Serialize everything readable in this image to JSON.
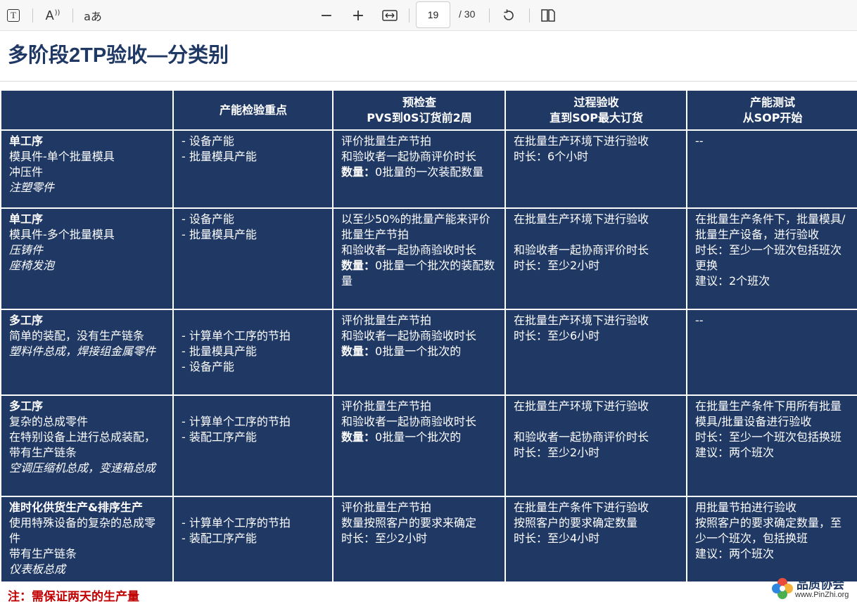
{
  "toolbar": {
    "text_tool_glyph": "T",
    "read_aloud_glyph": "A",
    "translate_glyph": "aあ",
    "zoom_out_glyph": "−",
    "zoom_in_glyph": "+",
    "page_current": "19",
    "page_total": "/ 30",
    "icons": [
      "text-select-icon",
      "read-aloud-icon",
      "translate-icon",
      "zoom-out-icon",
      "zoom-in-icon",
      "fit-width-icon",
      "rotate-icon",
      "page-view-icon"
    ]
  },
  "slide": {
    "title": "多阶段2TP验收—分类别",
    "headers": [
      [
        ""
      ],
      [
        "产能检验重点"
      ],
      [
        "预检查",
        "PVS到0S订货前2周"
      ],
      [
        "过程验收",
        "直到SOP最大订货"
      ],
      [
        "产能测试",
        "从SOP开始"
      ]
    ],
    "rows": [
      [
        [
          {
            "t": "单工序",
            "s": "b"
          },
          {
            "t": "模具件-单个批量模具",
            "s": ""
          },
          {
            "t": "冲压件",
            "s": ""
          },
          {
            "t": "注塑零件",
            "s": "i"
          }
        ],
        [
          {
            "t": "- 设备产能",
            "s": ""
          },
          {
            "t": "- 批量模具产能",
            "s": ""
          }
        ],
        [
          {
            "t": "评价批量生产节拍",
            "s": ""
          },
          {
            "t": "和验收者一起协商评价时长",
            "s": ""
          },
          {
            "t": "数量：",
            "s": "b",
            "rest": "0批量的一次装配数量"
          }
        ],
        [
          {
            "t": "在批量生产环境下进行验收",
            "s": ""
          },
          {
            "t": "时长：6个小时",
            "s": ""
          }
        ],
        [
          {
            "t": "--",
            "s": ""
          }
        ]
      ],
      [
        [
          {
            "t": "单工序",
            "s": "b"
          },
          {
            "t": "模具件-多个批量模具",
            "s": ""
          },
          {
            "t": "压铸件",
            "s": "i"
          },
          {
            "t": "座椅发泡",
            "s": "i"
          }
        ],
        [
          {
            "t": "- 设备产能",
            "s": ""
          },
          {
            "t": "- 批量模具产能",
            "s": ""
          }
        ],
        [
          {
            "t": "以至少50%的批量产能来评价批量生产节拍",
            "s": ""
          },
          {
            "t": "和验收者一起协商验收时长",
            "s": ""
          },
          {
            "t": "数量：",
            "s": "b",
            "rest": "0批量一个批次的装配数量"
          }
        ],
        [
          {
            "t": "在批量生产环境下进行验收",
            "s": ""
          },
          {
            "t": " ",
            "s": ""
          },
          {
            "t": "和验收者一起协商评价时长",
            "s": ""
          },
          {
            "t": "时长：至少2小时",
            "s": ""
          }
        ],
        [
          {
            "t": "在批量生产条件下，批量模具/批量生产设备，进行验收",
            "s": ""
          },
          {
            "t": "时长：至少一个班次包括班次更换",
            "s": ""
          },
          {
            "t": "建议：2个班次",
            "s": ""
          }
        ]
      ],
      [
        [
          {
            "t": "多工序",
            "s": "b"
          },
          {
            "t": "简单的装配，没有生产链条",
            "s": ""
          },
          {
            "t": "塑料件总成，焊接组金属零件",
            "s": "i"
          }
        ],
        [
          {
            "t": " ",
            "s": ""
          },
          {
            "t": "- 计算单个工序的节拍",
            "s": ""
          },
          {
            "t": "- 批量模具产能",
            "s": ""
          },
          {
            "t": "- 设备产能",
            "s": ""
          }
        ],
        [
          {
            "t": "评价批量生产节拍",
            "s": ""
          },
          {
            "t": "和验收者一起协商验收时长",
            "s": ""
          },
          {
            "t": "数量：",
            "s": "b",
            "rest": "0批量一个批次的"
          }
        ],
        [
          {
            "t": "在批量生产环境下进行验收",
            "s": ""
          },
          {
            "t": "时长：至少6小时",
            "s": ""
          }
        ],
        [
          {
            "t": "--",
            "s": ""
          }
        ]
      ],
      [
        [
          {
            "t": "多工序",
            "s": "b"
          },
          {
            "t": "复杂的总成零件",
            "s": ""
          },
          {
            "t": "在特别设备上进行总成装配，带有生产链条",
            "s": ""
          },
          {
            "t": "空调压缩机总成，变速箱总成",
            "s": "i"
          }
        ],
        [
          {
            "t": " ",
            "s": ""
          },
          {
            "t": "- 计算单个工序的节拍",
            "s": ""
          },
          {
            "t": "- 装配工序产能",
            "s": ""
          }
        ],
        [
          {
            "t": "评价批量生产节拍",
            "s": ""
          },
          {
            "t": "和验收者一起协商验收时长",
            "s": ""
          },
          {
            "t": "数量：",
            "s": "b",
            "rest": "0批量一个批次的"
          }
        ],
        [
          {
            "t": "在批量生产环境下进行验收",
            "s": ""
          },
          {
            "t": " ",
            "s": ""
          },
          {
            "t": "和验收者一起协商评价时长",
            "s": ""
          },
          {
            "t": "时长：至少2小时",
            "s": ""
          }
        ],
        [
          {
            "t": "在批量生产条件下用所有批量模具/批量设备进行验收",
            "s": ""
          },
          {
            "t": "时长：至少一个班次包括换班",
            "s": ""
          },
          {
            "t": "建议：两个班次",
            "s": ""
          }
        ]
      ],
      [
        [
          {
            "t": "准时化供货生产&排序生产",
            "s": "b"
          },
          {
            "t": "使用特殊设备的复杂的总成零件",
            "s": ""
          },
          {
            "t": "带有生产链条",
            "s": ""
          },
          {
            "t": "仪表板总成",
            "s": "i"
          }
        ],
        [
          {
            "t": " ",
            "s": ""
          },
          {
            "t": "- 计算单个工序的节拍",
            "s": ""
          },
          {
            "t": "- 装配工序产能",
            "s": ""
          }
        ],
        [
          {
            "t": "评价批量生产节拍",
            "s": ""
          },
          {
            "t": "数量按照客户的要求来确定",
            "s": ""
          },
          {
            "t": "时长：至少2小时",
            "s": ""
          }
        ],
        [
          {
            "t": "在批量生产条件下进行验收",
            "s": ""
          },
          {
            "t": "按照客户的要求确定数量",
            "s": ""
          },
          {
            "t": "时长：至少4小时",
            "s": ""
          }
        ],
        [
          {
            "t": "用批量节拍进行验收",
            "s": ""
          },
          {
            "t": "按照客户的要求确定数量，至少一个班次，包括换班",
            "s": ""
          },
          {
            "t": "建议：两个班次",
            "s": ""
          }
        ]
      ]
    ],
    "note": "注：需保证两天的生产量",
    "logo_cn": "品质协会",
    "logo_url": "www.PinZhi.org"
  }
}
